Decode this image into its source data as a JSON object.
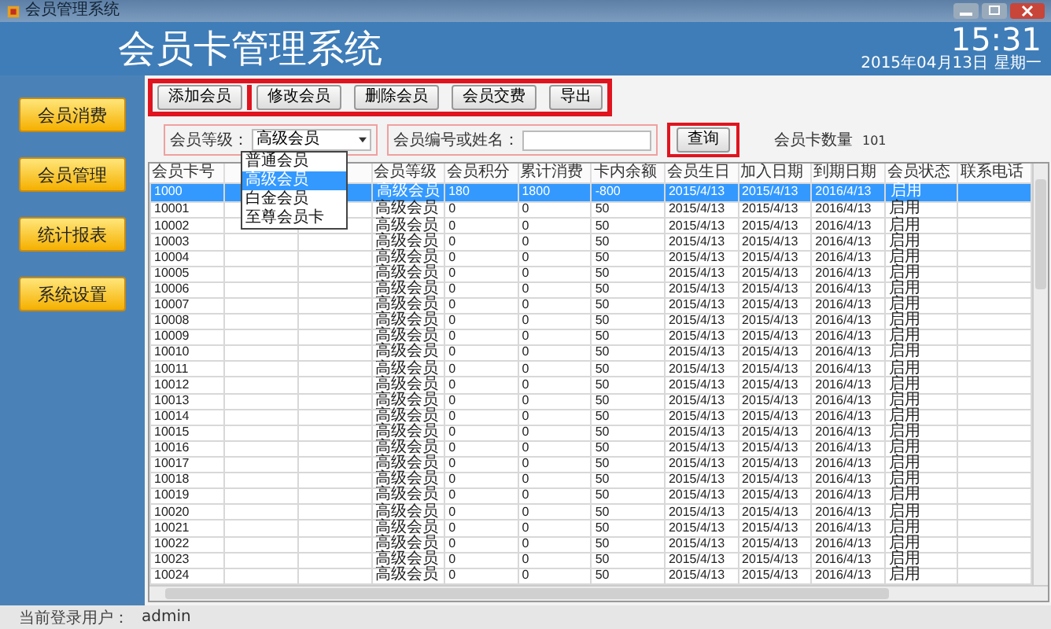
{
  "window": {
    "title": "会员管理系统"
  },
  "header": {
    "title": "会员卡管理系统",
    "time": "15:31",
    "date": "2015年04月13日",
    "weekday": "星期一"
  },
  "sidebar": {
    "items": [
      {
        "label": "会员消费"
      },
      {
        "label": "会员管理"
      },
      {
        "label": "统计报表"
      },
      {
        "label": "系统设置"
      }
    ]
  },
  "toolbar": {
    "groups": [
      [
        "添加会员"
      ],
      [
        "修改会员",
        "删除会员",
        "会员交费",
        "导出"
      ]
    ]
  },
  "filter": {
    "level_label": "会员等级：",
    "level_value": "高级会员",
    "level_options": [
      {
        "label": "普通会员",
        "selected": false
      },
      {
        "label": "高级会员",
        "selected": true
      },
      {
        "label": "白金会员",
        "selected": false
      },
      {
        "label": "至尊会员卡",
        "selected": false
      }
    ],
    "search_label": "会员编号或姓名：",
    "search_button": "查询",
    "count_label": "会员卡数量",
    "count_value": "101"
  },
  "table": {
    "columns": [
      "会员卡号",
      "会员等级",
      "会员积分",
      "累计消费",
      "卡内余额",
      "会员生日",
      "加入日期",
      "到期日期",
      "会员状态",
      "联系电话"
    ],
    "rows": [
      {
        "cells": [
          "1000",
          "高级会员",
          "180",
          "1800",
          "-800",
          "2015/4/13",
          "2015/4/13",
          "2016/4/13",
          "启用"
        ],
        "selected": true
      },
      {
        "cells": [
          "10001",
          "高级会员",
          "0",
          "0",
          "50",
          "2015/4/13",
          "2015/4/13",
          "2016/4/13",
          "启用"
        ],
        "selected": false
      },
      {
        "cells": [
          "10002",
          "高级会员",
          "0",
          "0",
          "50",
          "2015/4/13",
          "2015/4/13",
          "2016/4/13",
          "启用"
        ],
        "selected": false
      },
      {
        "cells": [
          "10003",
          "高级会员",
          "0",
          "0",
          "50",
          "2015/4/13",
          "2015/4/13",
          "2016/4/13",
          "启用"
        ],
        "selected": false
      },
      {
        "cells": [
          "10004",
          "高级会员",
          "0",
          "0",
          "50",
          "2015/4/13",
          "2015/4/13",
          "2016/4/13",
          "启用"
        ],
        "selected": false
      },
      {
        "cells": [
          "10005",
          "高级会员",
          "0",
          "0",
          "50",
          "2015/4/13",
          "2015/4/13",
          "2016/4/13",
          "启用"
        ],
        "selected": false
      },
      {
        "cells": [
          "10006",
          "高级会员",
          "0",
          "0",
          "50",
          "2015/4/13",
          "2015/4/13",
          "2016/4/13",
          "启用"
        ],
        "selected": false
      },
      {
        "cells": [
          "10007",
          "高级会员",
          "0",
          "0",
          "50",
          "2015/4/13",
          "2015/4/13",
          "2016/4/13",
          "启用"
        ],
        "selected": false
      },
      {
        "cells": [
          "10008",
          "高级会员",
          "0",
          "0",
          "50",
          "2015/4/13",
          "2015/4/13",
          "2016/4/13",
          "启用"
        ],
        "selected": false
      },
      {
        "cells": [
          "10009",
          "高级会员",
          "0",
          "0",
          "50",
          "2015/4/13",
          "2015/4/13",
          "2016/4/13",
          "启用"
        ],
        "selected": false
      },
      {
        "cells": [
          "10010",
          "高级会员",
          "0",
          "0",
          "50",
          "2015/4/13",
          "2015/4/13",
          "2016/4/13",
          "启用"
        ],
        "selected": false
      },
      {
        "cells": [
          "10011",
          "高级会员",
          "0",
          "0",
          "50",
          "2015/4/13",
          "2015/4/13",
          "2016/4/13",
          "启用"
        ],
        "selected": false
      },
      {
        "cells": [
          "10012",
          "高级会员",
          "0",
          "0",
          "50",
          "2015/4/13",
          "2015/4/13",
          "2016/4/13",
          "启用"
        ],
        "selected": false
      },
      {
        "cells": [
          "10013",
          "高级会员",
          "0",
          "0",
          "50",
          "2015/4/13",
          "2015/4/13",
          "2016/4/13",
          "启用"
        ],
        "selected": false
      },
      {
        "cells": [
          "10014",
          "高级会员",
          "0",
          "0",
          "50",
          "2015/4/13",
          "2015/4/13",
          "2016/4/13",
          "启用"
        ],
        "selected": false
      },
      {
        "cells": [
          "10015",
          "高级会员",
          "0",
          "0",
          "50",
          "2015/4/13",
          "2015/4/13",
          "2016/4/13",
          "启用"
        ],
        "selected": false
      },
      {
        "cells": [
          "10016",
          "高级会员",
          "0",
          "0",
          "50",
          "2015/4/13",
          "2015/4/13",
          "2016/4/13",
          "启用"
        ],
        "selected": false
      },
      {
        "cells": [
          "10017",
          "高级会员",
          "0",
          "0",
          "50",
          "2015/4/13",
          "2015/4/13",
          "2016/4/13",
          "启用"
        ],
        "selected": false
      },
      {
        "cells": [
          "10018",
          "高级会员",
          "0",
          "0",
          "50",
          "2015/4/13",
          "2015/4/13",
          "2016/4/13",
          "启用"
        ],
        "selected": false
      },
      {
        "cells": [
          "10019",
          "高级会员",
          "0",
          "0",
          "50",
          "2015/4/13",
          "2015/4/13",
          "2016/4/13",
          "启用"
        ],
        "selected": false
      },
      {
        "cells": [
          "10020",
          "高级会员",
          "0",
          "0",
          "50",
          "2015/4/13",
          "2015/4/13",
          "2016/4/13",
          "启用"
        ],
        "selected": false
      },
      {
        "cells": [
          "10021",
          "高级会员",
          "0",
          "0",
          "50",
          "2015/4/13",
          "2015/4/13",
          "2016/4/13",
          "启用"
        ],
        "selected": false
      },
      {
        "cells": [
          "10022",
          "高级会员",
          "0",
          "0",
          "50",
          "2015/4/13",
          "2015/4/13",
          "2016/4/13",
          "启用"
        ],
        "selected": false
      },
      {
        "cells": [
          "10023",
          "高级会员",
          "0",
          "0",
          "50",
          "2015/4/13",
          "2015/4/13",
          "2016/4/13",
          "启用"
        ],
        "selected": false
      },
      {
        "cells": [
          "10024",
          "高级会员",
          "0",
          "0",
          "50",
          "2015/4/13",
          "2015/4/13",
          "2016/4/13",
          "启用"
        ],
        "selected": false
      }
    ]
  },
  "status_bar": {
    "label": "当前登录用户：",
    "user": "admin"
  }
}
